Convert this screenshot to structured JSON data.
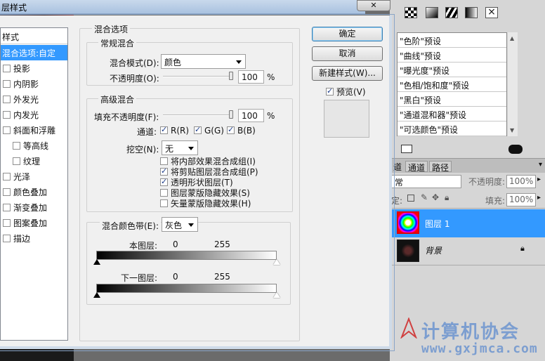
{
  "dialog": {
    "title": "层样式",
    "close_label": "✕"
  },
  "style_list": {
    "header": "样式",
    "items": [
      {
        "label": "混合选项:自定",
        "checkbox": false,
        "checked": false,
        "selected": true,
        "indent": false
      },
      {
        "label": "投影",
        "checkbox": true,
        "checked": false,
        "selected": false,
        "indent": false
      },
      {
        "label": "内阴影",
        "checkbox": true,
        "checked": false,
        "selected": false,
        "indent": false
      },
      {
        "label": "外发光",
        "checkbox": true,
        "checked": false,
        "selected": false,
        "indent": false
      },
      {
        "label": "内发光",
        "checkbox": true,
        "checked": false,
        "selected": false,
        "indent": false
      },
      {
        "label": "斜面和浮雕",
        "checkbox": true,
        "checked": false,
        "selected": false,
        "indent": false
      },
      {
        "label": "等高线",
        "checkbox": true,
        "checked": false,
        "selected": false,
        "indent": true
      },
      {
        "label": "纹理",
        "checkbox": true,
        "checked": false,
        "selected": false,
        "indent": true
      },
      {
        "label": "光泽",
        "checkbox": true,
        "checked": false,
        "selected": false,
        "indent": false
      },
      {
        "label": "颜色叠加",
        "checkbox": true,
        "checked": false,
        "selected": false,
        "indent": false
      },
      {
        "label": "渐变叠加",
        "checkbox": true,
        "checked": false,
        "selected": false,
        "indent": false
      },
      {
        "label": "图案叠加",
        "checkbox": true,
        "checked": false,
        "selected": false,
        "indent": false
      },
      {
        "label": "描边",
        "checkbox": true,
        "checked": false,
        "selected": false,
        "indent": false
      }
    ]
  },
  "blending": {
    "section_title": "混合选项",
    "general": {
      "title": "常规混合",
      "mode_label": "混合模式(D):",
      "mode_value": "颜色",
      "opacity_label": "不透明度(O):",
      "opacity_value": "100",
      "percent": "%"
    },
    "advanced": {
      "title": "高级混合",
      "fill_label": "填充不透明度(F):",
      "fill_value": "100",
      "percent": "%",
      "channels_label": "通道:",
      "channels": [
        {
          "label": "R(R)",
          "checked": true
        },
        {
          "label": "G(G)",
          "checked": true
        },
        {
          "label": "B(B)",
          "checked": true
        }
      ],
      "knockout_label": "挖空(N):",
      "knockout_value": "无",
      "options": [
        {
          "label": "将内部效果混合成组(I)",
          "checked": false
        },
        {
          "label": "将剪贴图层混合成组(P)",
          "checked": true
        },
        {
          "label": "透明形状图层(T)",
          "checked": true
        },
        {
          "label": "图层蒙版隐藏效果(S)",
          "checked": false
        },
        {
          "label": "矢量蒙版隐藏效果(H)",
          "checked": false
        }
      ]
    },
    "blend_if": {
      "label": "混合颜色带(E):",
      "value": "灰色",
      "this_layer_label": "本图层:",
      "this_layer_min": "0",
      "this_layer_max": "255",
      "underlying_label": "下一图层:",
      "underlying_min": "0",
      "underlying_max": "255"
    }
  },
  "buttons": {
    "ok": "确定",
    "cancel": "取消",
    "new_style": "新建样式(W)...",
    "preview_label": "预览(V)",
    "preview_checked": true
  },
  "presets": {
    "items": [
      "\"色阶\"预设",
      "\"曲线\"预设",
      "\"曝光度\"预设",
      "\"色相/饱和度\"预设",
      "\"黑白\"预设",
      "\"通道混和器\"预设",
      "\"可选颜色\"预设"
    ]
  },
  "layers_panel": {
    "tabs": [
      "道",
      "通道",
      "路径"
    ],
    "blend_mode": "常",
    "opacity_label": "不透明度:",
    "opacity_value": "100%",
    "lock_label": "定:",
    "fill_label": "填充:",
    "fill_value": "100%",
    "layers": [
      {
        "name": "图层 1",
        "selected": true
      },
      {
        "name": "背景",
        "selected": false
      }
    ]
  },
  "watermark": {
    "title": "计算机协会",
    "url": "www.gxjmca.com"
  },
  "colors": {
    "selection": "#3399ff",
    "dialog_bg": "#f0f0f0",
    "watermark": "#7c9ed0"
  }
}
